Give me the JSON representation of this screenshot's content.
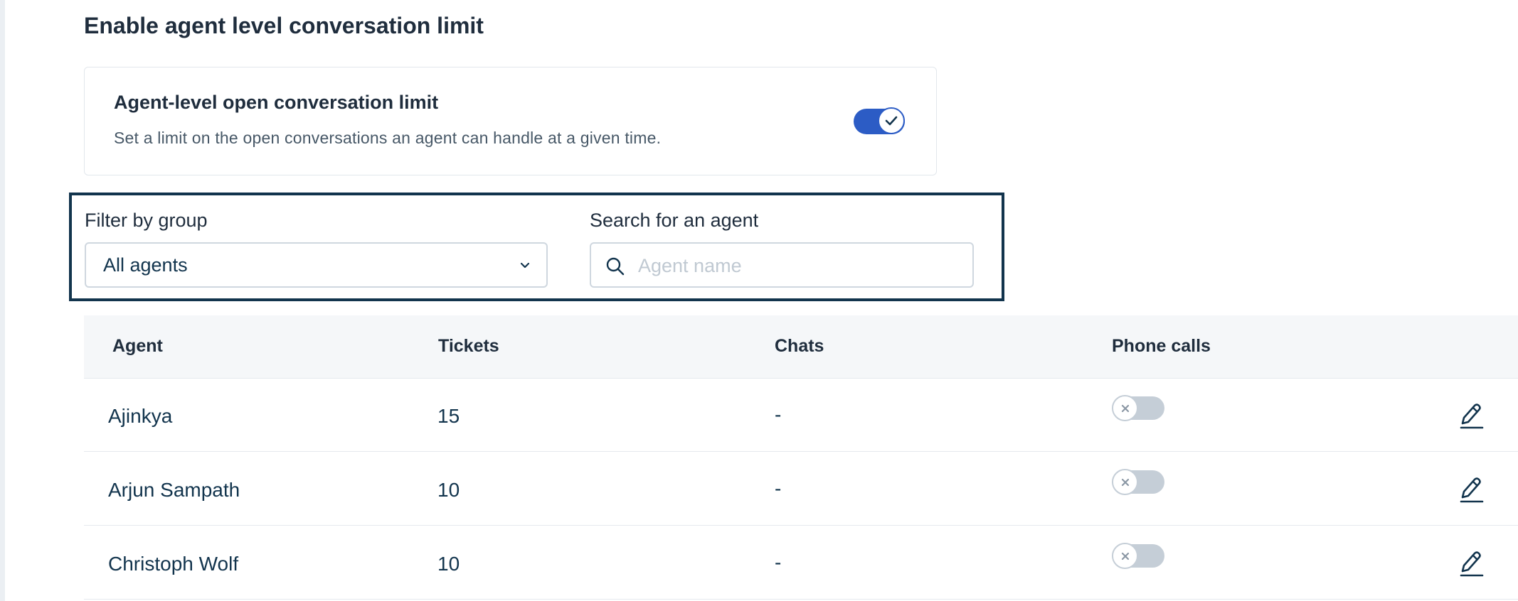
{
  "section": {
    "title": "Enable agent level conversation limit"
  },
  "card": {
    "title": "Agent-level open conversation limit",
    "description": "Set a limit on the open conversations an agent can handle at a given time.",
    "toggle_enabled": true
  },
  "filters": {
    "group_label": "Filter by group",
    "group_value": "All agents",
    "search_label": "Search for an agent",
    "search_placeholder": "Agent name"
  },
  "table": {
    "columns": [
      "Agent",
      "Tickets",
      "Chats",
      "Phone calls"
    ],
    "rows": [
      {
        "agent": "Ajinkya",
        "tickets": "15",
        "chats": "-",
        "phone_enabled": false
      },
      {
        "agent": "Arjun Sampath",
        "tickets": "10",
        "chats": "-",
        "phone_enabled": false
      },
      {
        "agent": "Christoph Wolf",
        "tickets": "10",
        "chats": "-",
        "phone_enabled": false
      }
    ]
  },
  "icons": {
    "toggle_on": "check-icon",
    "toggle_off": "x-icon",
    "select": "chevron-down-icon",
    "search": "search-icon",
    "edit": "pencil-icon"
  },
  "colors": {
    "accent": "#2c5cc5",
    "text": "#12344d",
    "toggle_off": "#c5ced7",
    "focus_border": "#12344d"
  }
}
